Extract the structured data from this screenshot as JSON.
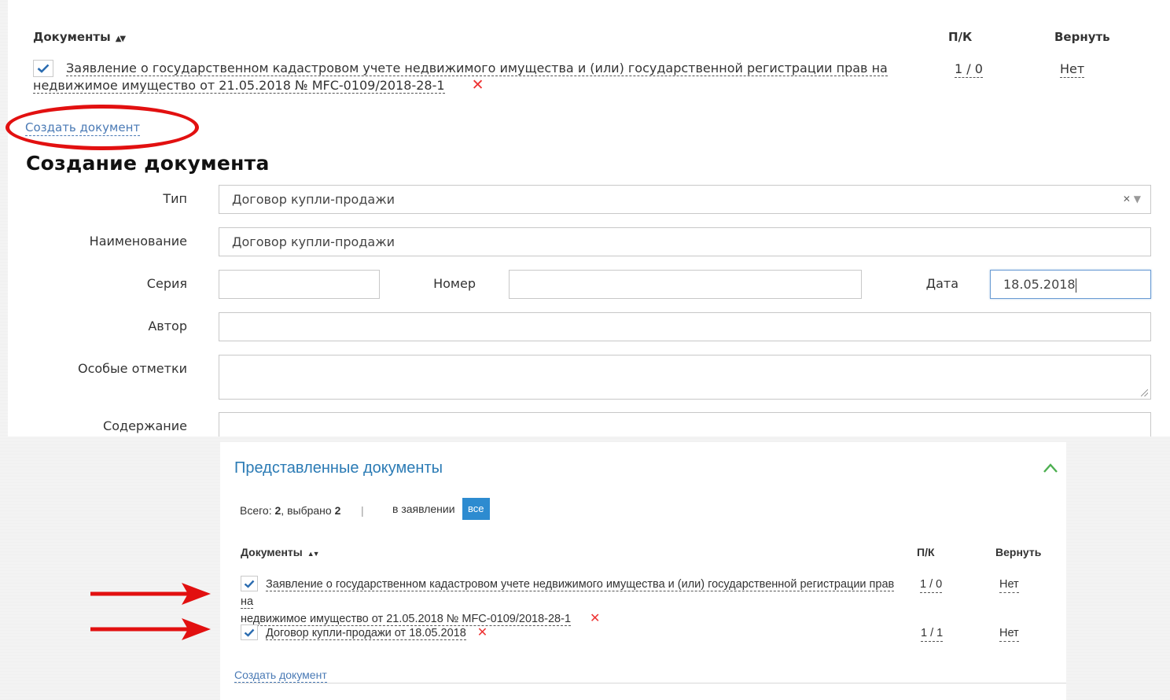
{
  "colors": {
    "link": "#4a7ab5",
    "accent_blue": "#2d8bd0",
    "delete_red": "#e33333",
    "annotation_red": "#e21010"
  },
  "top": {
    "table_header": {
      "documents": "Документы",
      "pk": "П/К",
      "return": "Вернуть"
    },
    "doc1": {
      "line1": "Заявление о государственном кадастровом учете недвижимого имущества и (или) государственной регистрации прав на",
      "line2": "недвижимое имущество от 21.05.2018 № MFC-0109/2018-28-1",
      "pk": "1 / 0",
      "return": "Нет",
      "checked": true
    },
    "create_link": "Создать документ",
    "form_title": "Создание документа",
    "labels": {
      "type": "Тип",
      "name": "Наименование",
      "series": "Серия",
      "number": "Номер",
      "date": "Дата",
      "author": "Автор",
      "notes": "Особые отметки",
      "content": "Содержание"
    },
    "values": {
      "type": "Договор купли-продажи",
      "name": "Договор купли-продажи",
      "series": "",
      "number": "",
      "date": "18.05.2018",
      "author": "",
      "notes": "",
      "content": ""
    }
  },
  "bottom": {
    "title": "Представленные документы",
    "summary_total_label": "Всего: ",
    "summary_total": "2",
    "summary_selected_label": ", выбрано ",
    "summary_selected": "2",
    "separator": "|",
    "filter_label": "в заявлении",
    "filter_badge": "все",
    "table_header": {
      "documents": "Документы",
      "pk": "П/К",
      "return": "Вернуть"
    },
    "rows": [
      {
        "line1": "Заявление о государственном кадастровом учете недвижимого имущества и (или) государственной регистрации прав на",
        "line2": "недвижимое имущество от 21.05.2018 № MFC-0109/2018-28-1",
        "pk": "1 / 0",
        "return": "Нет",
        "checked": true
      },
      {
        "line1": "Договор купли-продажи от 18.05.2018",
        "pk": "1 / 1",
        "return": "Нет",
        "checked": true
      }
    ],
    "create_link": "Создать документ"
  }
}
